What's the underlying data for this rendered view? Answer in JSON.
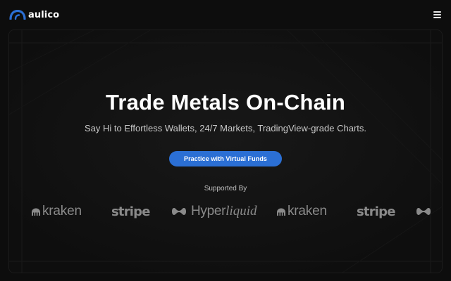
{
  "brand": {
    "name": "aulico",
    "logo_icon": "arc-logo-icon",
    "accent": "#2b6fd4"
  },
  "header": {
    "menu_icon": "hamburger-menu-icon"
  },
  "hero": {
    "headline": "Trade Metals On-Chain",
    "subheadline": "Say Hi to Effortless Wallets, 24/7 Markets, TradingView-grade Charts.",
    "cta_label": "Practice with Virtual Funds",
    "supported_label": "Supported By"
  },
  "partners": [
    {
      "name": "kraken",
      "icon": "kraken-icon",
      "text": "kraken"
    },
    {
      "name": "stripe",
      "text": "stripe"
    },
    {
      "name": "hyperliquid",
      "icon": "hyperliquid-icon",
      "text_regular": "Hyper",
      "text_italic": "liquid"
    },
    {
      "name": "kraken",
      "icon": "kraken-icon",
      "text": "kraken"
    },
    {
      "name": "stripe",
      "text": "stripe"
    },
    {
      "name": "hyperliquid",
      "icon": "hyperliquid-icon"
    }
  ],
  "colors": {
    "background": "#0d0d0d",
    "cta_background": "#2b6fd4",
    "partner_logo": "#8a8a8a"
  }
}
